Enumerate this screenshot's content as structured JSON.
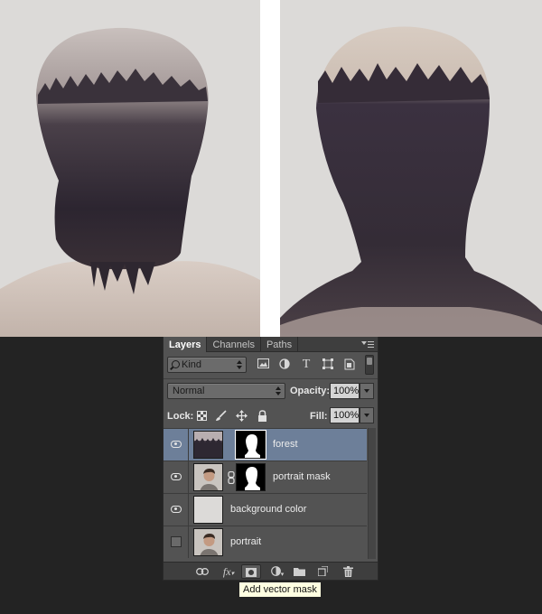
{
  "panel": {
    "tabs": [
      {
        "label": "Layers"
      },
      {
        "label": "Channels"
      },
      {
        "label": "Paths"
      }
    ],
    "filter": {
      "kind_label": "Kind",
      "icons": [
        "image-filter-icon",
        "adjustment-filter-icon",
        "type-filter-icon",
        "shape-filter-icon",
        "smart-object-filter-icon"
      ]
    },
    "blend_mode": "Normal",
    "opacity_label": "Opacity:",
    "opacity_value": "100%",
    "lock_label": "Lock:",
    "fill_label": "Fill:",
    "fill_value": "100%",
    "layers": [
      {
        "name": "forest",
        "visible": true,
        "selected": true,
        "has_mask": true
      },
      {
        "name": "portrait mask",
        "visible": true,
        "selected": false,
        "has_mask": true
      },
      {
        "name": "background color",
        "visible": true,
        "selected": false,
        "has_mask": false
      },
      {
        "name": "portrait",
        "visible": false,
        "selected": false,
        "has_mask": false
      }
    ],
    "footer_icons": [
      "link-layers-icon",
      "fx-icon",
      "add-mask-icon",
      "adjustment-layer-icon",
      "group-folder-icon",
      "new-layer-icon",
      "trash-icon"
    ]
  },
  "tooltip": {
    "text": "Add vector mask"
  },
  "colors": {
    "selection": "#6d7f99",
    "panel_bg": "#535353",
    "canvas_bg": "#dcdad8"
  }
}
